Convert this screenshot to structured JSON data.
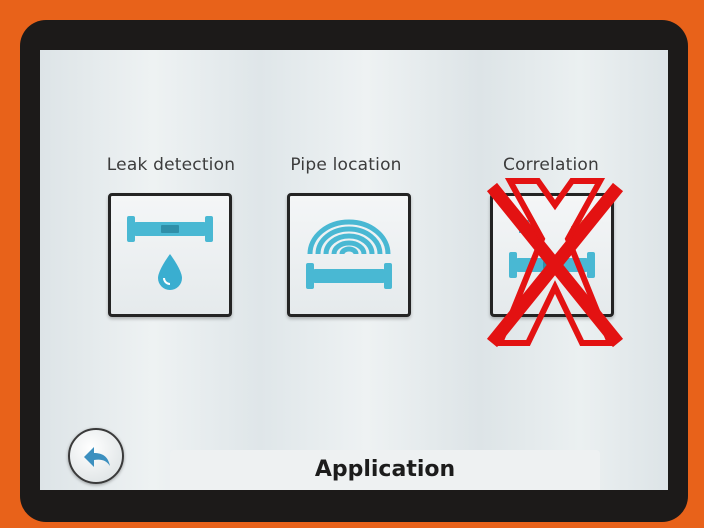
{
  "screen": {
    "title": "Application",
    "tiles": [
      {
        "label": "Leak detection",
        "icon": "pipe-water-drop-icon"
      },
      {
        "label": "Pipe location",
        "icon": "pipe-signal-waves-icon"
      },
      {
        "label": "Correlation",
        "icon": "correlation-sensors-icon",
        "crossed_out": true
      }
    ],
    "back_button": {
      "icon": "back-arrow-icon"
    }
  },
  "colors": {
    "device_housing": "#e8621a",
    "bezel": "#1c1a19",
    "icon_blue": "#49b8d3",
    "icon_orange": "#e2a06b",
    "cross_red": "#e31212"
  }
}
